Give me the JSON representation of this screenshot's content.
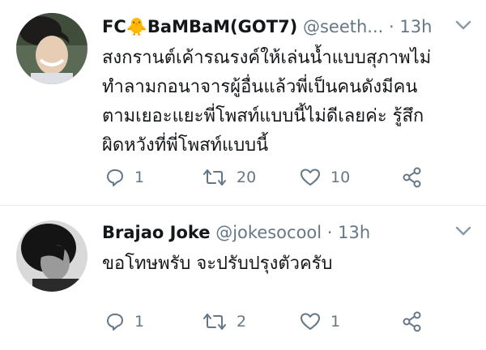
{
  "tweets": [
    {
      "display_name": "FC🐥BaMBaM(GOT7)",
      "handle": "@seeth...",
      "dot": "·",
      "time": "13h",
      "body_lines": [
        "สงกรานต์เค้ารณรงค์ให้เล่นน้ำแบบสุภาพไม่",
        "ทำลามกอนาจารผู้อื่นแล้วพี่เป็นคนดังมีคน",
        "ตามเยอะแยะพี่โพสท์แบบนี้ไม่ดีเลยค่ะ รู้สึก",
        "ผิดหวังที่พี่โพสท์แบบนี้"
      ],
      "reply_count": "1",
      "retweet_count": "20",
      "like_count": "10"
    },
    {
      "display_name": "Brajao Joke",
      "handle": "@jokesocool",
      "dot": "·",
      "time": "13h",
      "body_lines": [
        "ขอโทษพรับ จะปรับปรุงตัวครับ"
      ],
      "reply_count": "1",
      "retweet_count": "2",
      "like_count": "1"
    }
  ],
  "icons": {
    "reply": "reply-icon",
    "retweet": "retweet-icon",
    "like": "heart-icon",
    "share": "share-icon",
    "menu": "chevron-down-icon"
  },
  "colors": {
    "text": "#14171a",
    "secondary": "#657786",
    "divider": "#e6ecf0"
  }
}
